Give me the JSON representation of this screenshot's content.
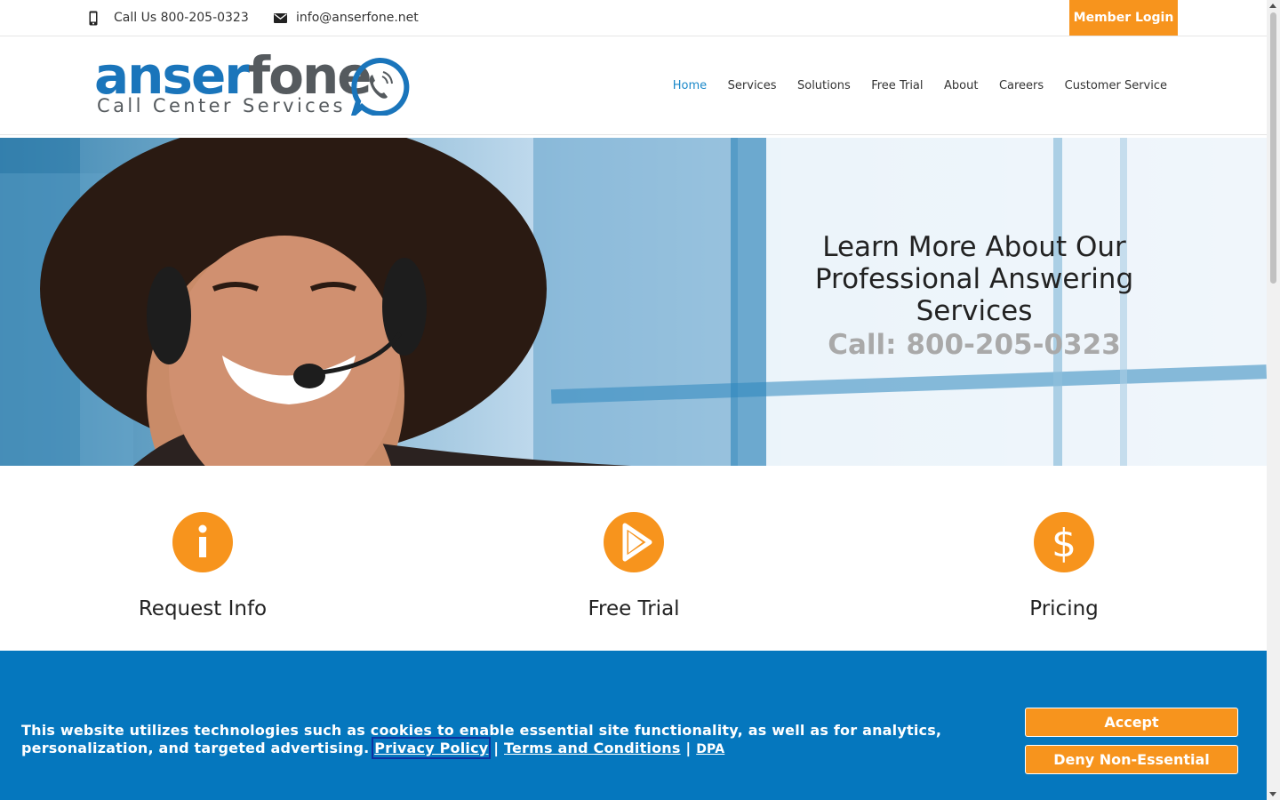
{
  "topbar": {
    "phone_text": "Call Us 800-205-0323",
    "email_text": "info@anserfone.net",
    "member_login": "Member Login"
  },
  "logo": {
    "word_part1": "anser",
    "word_part2": "fone",
    "subtitle": "Call Center Services"
  },
  "nav": {
    "items": [
      "Home",
      "Services",
      "Solutions",
      "Free Trial",
      "About",
      "Careers",
      "Customer Service"
    ],
    "active": "Home"
  },
  "hero": {
    "line1": "Learn More About Our",
    "line2": "Professional Answering Services",
    "call": "Call: 800-205-0323"
  },
  "features": [
    {
      "label": "Request Info",
      "icon": "info-icon"
    },
    {
      "label": "Free Trial",
      "icon": "play-icon"
    },
    {
      "label": "Pricing",
      "icon": "dollar-icon"
    }
  ],
  "cookie": {
    "text": "This website utilizes technologies such as cookies to enable essential site functionality, as well as for analytics, personalization, and targeted advertising.",
    "privacy_link": "Privacy Policy",
    "separator": "|",
    "terms_link": "Terms and Conditions",
    "dpa_link": "DPA",
    "accept": "Accept",
    "deny": "Deny Non-Essential"
  },
  "colors": {
    "accent_orange": "#f7941d",
    "brand_blue": "#1a75bb",
    "banner_blue": "#0577be",
    "nav_active": "#1a88c9"
  }
}
